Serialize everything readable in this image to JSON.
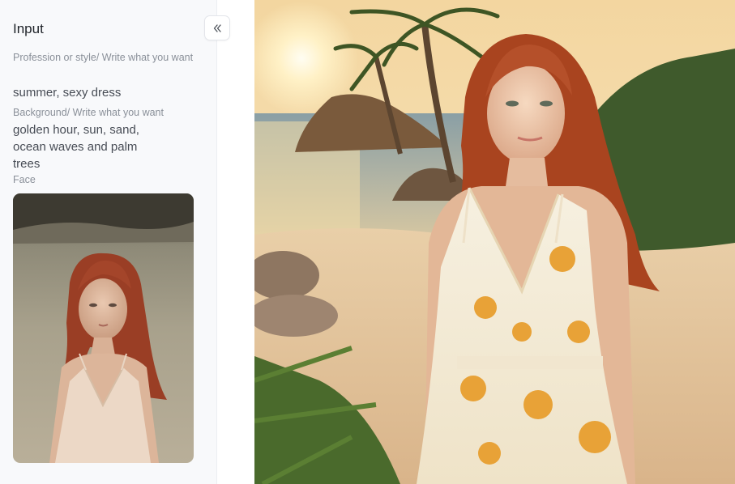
{
  "sidebar": {
    "title": "Input",
    "profession_label": "Profession or style/ Write what you want",
    "profession_value": "summer, sexy dress",
    "background_label": "Background/ Write what you want",
    "background_value": "golden hour, sun, sand, ocean waves and palm trees",
    "face_label": "Face",
    "collapse_icon": "double-chevron-left-icon"
  },
  "colors": {
    "sidebar_bg": "#f8f9fb",
    "label": "#8a9099",
    "value": "#474c55",
    "title": "#1f2329"
  }
}
